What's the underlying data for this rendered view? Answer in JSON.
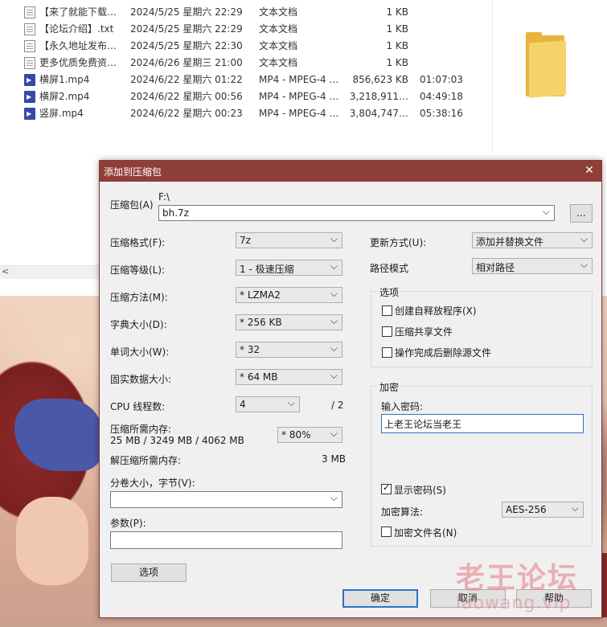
{
  "explorer": {
    "files": [
      {
        "icon": "txt-file-icon",
        "name": "【来了就能下载…",
        "date": "2024/5/25 星期六 22:29",
        "type": "文本文档",
        "size": "1 KB",
        "duration": ""
      },
      {
        "icon": "txt-file-icon",
        "name": "【论坛介绍】.txt",
        "date": "2024/5/25 星期六 22:29",
        "type": "文本文档",
        "size": "1 KB",
        "duration": ""
      },
      {
        "icon": "txt-file-icon",
        "name": "【永久地址发布…",
        "date": "2024/5/25 星期六 22:30",
        "type": "文本文档",
        "size": "1 KB",
        "duration": ""
      },
      {
        "icon": "txt-file-icon",
        "name": "更多优质免费资…",
        "date": "2024/6/26 星期三 21:00",
        "type": "文本文档",
        "size": "1 KB",
        "duration": ""
      },
      {
        "icon": "mp4-file-icon",
        "name": "横屏1.mp4",
        "date": "2024/6/22 星期六 01:22",
        "type": "MP4 - MPEG-4 …",
        "size": "856,623 KB",
        "duration": "01:07:03"
      },
      {
        "icon": "mp4-file-icon",
        "name": "横屏2.mp4",
        "date": "2024/6/22 星期六 00:56",
        "type": "MP4 - MPEG-4 …",
        "size": "3,218,911…",
        "duration": "04:49:18"
      },
      {
        "icon": "mp4-file-icon",
        "name": "竖屏.mp4",
        "date": "2024/6/22 星期六 00:23",
        "type": "MP4 - MPEG-4 …",
        "size": "3,804,747…",
        "duration": "05:38:16"
      }
    ],
    "scroll_left": "<"
  },
  "dialog": {
    "title": "添加到压缩包",
    "close": "✕",
    "archive_label": "压缩包(A)",
    "archive_path": "F:\\",
    "archive_name": "bh.7z",
    "browse_label": "...",
    "format_label": "压缩格式(F):",
    "format_value": "7z",
    "level_label": "压缩等级(L):",
    "level_value": "1 - 极速压缩",
    "method_label": "压缩方法(M):",
    "method_value": "* LZMA2",
    "dict_label": "字典大小(D):",
    "dict_value": "* 256 KB",
    "word_label": "单词大小(W):",
    "word_value": "* 32",
    "solid_label": "固实数据大小:",
    "solid_value": "* 64 MB",
    "cpu_label": "CPU 线程数:",
    "cpu_value": "4",
    "cpu_total": "/ 2",
    "mem_compress_label": "压缩所需内存:",
    "mem_compress_value": "25 MB / 3249 MB / 4062 MB",
    "mem_percent": "* 80%",
    "mem_decompress_label": "解压缩所需内存:",
    "mem_decompress_value": "3 MB",
    "volume_label": "分卷大小，字节(V):",
    "volume_value": "",
    "params_label": "参数(P):",
    "params_value": "",
    "options_button": "选项",
    "update_label": "更新方式(U):",
    "update_value": "添加并替换文件",
    "pathmode_label": "路径模式",
    "pathmode_value": "相对路径",
    "options_group": "选项",
    "opt_sfx": "创建自释放程序(X)",
    "opt_shared": "压缩共享文件",
    "opt_delete": "操作完成后删除源文件",
    "encrypt_group": "加密",
    "password_label": "输入密码:",
    "password_value": "上老王论坛当老王",
    "show_password": "显示密码(S)",
    "enc_method_label": "加密算法:",
    "enc_method_value": "AES-256",
    "encrypt_names": "加密文件名(N)",
    "ok_button": "确定",
    "cancel_button": "取消",
    "help_button": "帮助"
  },
  "watermark": {
    "cn": "老王论坛",
    "en": "laowang.vip"
  }
}
